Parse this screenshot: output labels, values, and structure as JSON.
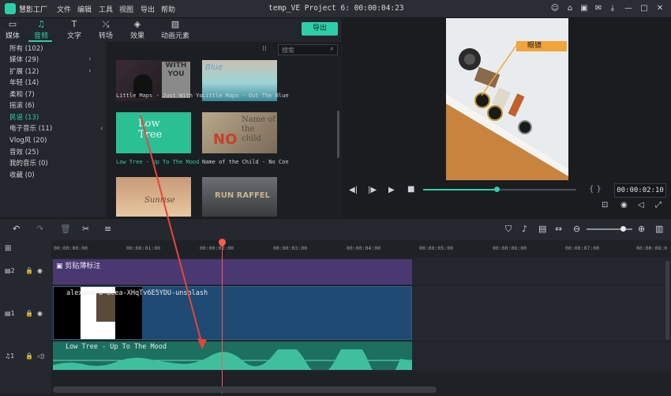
{
  "app": {
    "name": "慧影工厂",
    "window_title": "temp_VE Project 6: 00:00:04:23"
  },
  "menu": [
    "文件",
    "编辑",
    "工具",
    "视图",
    "导出",
    "帮助"
  ],
  "tabs": [
    {
      "label": "媒体",
      "icon": "folder-icon"
    },
    {
      "label": "音频",
      "icon": "music-note-icon"
    },
    {
      "label": "文字",
      "icon": "text-icon"
    },
    {
      "label": "转场",
      "icon": "transition-icon"
    },
    {
      "label": "效果",
      "icon": "effects-icon"
    },
    {
      "label": "动画元素",
      "icon": "image-icon"
    }
  ],
  "export_label": "导出",
  "categories": [
    "所有 (102)",
    "媒体 (29)",
    "扩展 (12)",
    "年轻 (14)",
    "柔和 (7)",
    "摇滚 (6)",
    "民谣 (13)",
    "电子音乐 (11)",
    "Vlog风 (20)",
    "音效 (25)",
    "我的音乐 (0)",
    "收藏 (0)"
  ],
  "search": {
    "placeholder": "搜索"
  },
  "media_items": [
    {
      "caption": "Little Maps - Just With Yo",
      "thumb_text": "WITH YOU"
    },
    {
      "caption": "Little Maps - Out The Blue",
      "thumb_text": "Blue"
    },
    {
      "caption": "Low Tree - Up To The Mood",
      "thumb_text": "Low Tree"
    },
    {
      "caption": "Name of the Child - No Con",
      "thumb_text": "Name of the child"
    },
    {
      "caption": "",
      "thumb_text": "Sunrise"
    },
    {
      "caption": "",
      "thumb_text": "RUN RAFFEL"
    }
  ],
  "preview": {
    "callout_label": "眼镜",
    "timecode": "00:00:02:10",
    "progress": 0.48
  },
  "ruler_labels": [
    "00:00:00:00",
    "00:00:01:00",
    "00:00:02:00",
    "00:00:03:00",
    "00:00:04:00",
    "00:00:05:00",
    "00:00:06:00",
    "00:00:07:00",
    "00:00:08:0"
  ],
  "tracks": {
    "clip_label": "剪贴薄标注",
    "video_label": "alexandru-acea-XHqTv6E5YDU-unsplash",
    "audio_label": "Low Tree - Up To The Mood",
    "track_numbers": [
      "2",
      "1",
      "1"
    ]
  },
  "colors": {
    "accent": "#2ecfa8",
    "playhead": "#ff5a4a",
    "callout": "#f2a33a"
  }
}
